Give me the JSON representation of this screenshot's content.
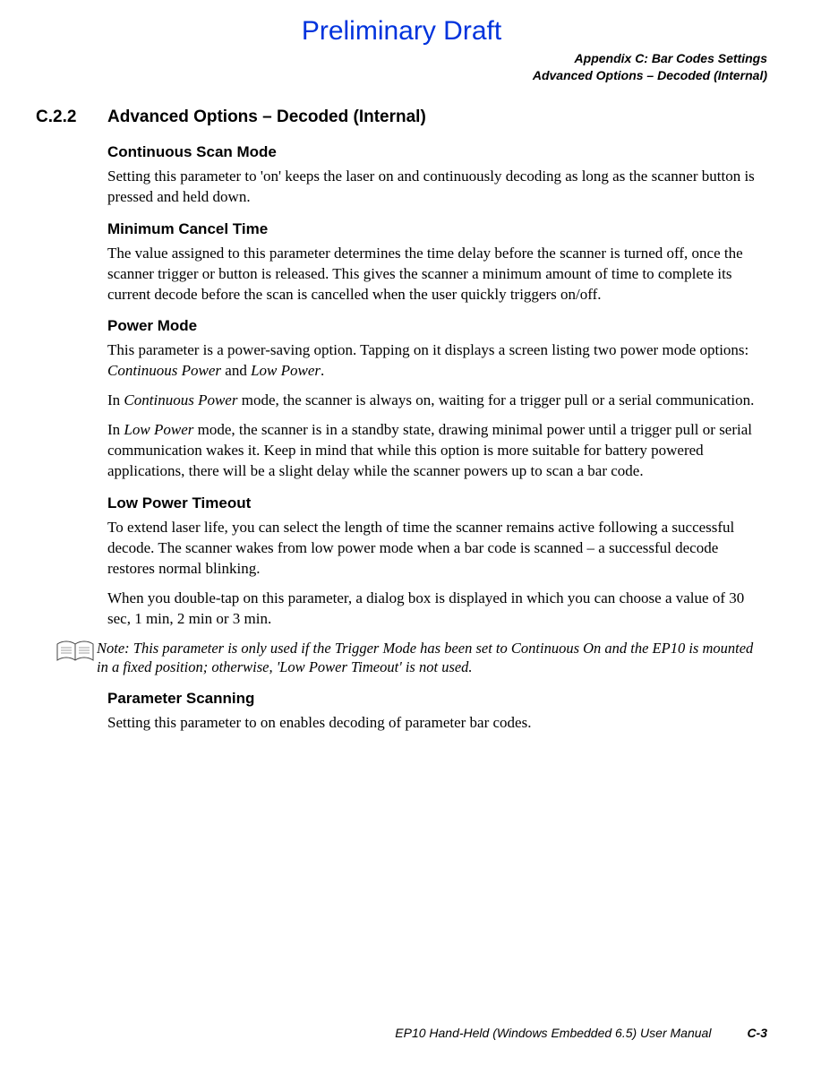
{
  "draft_banner": "Preliminary Draft",
  "header": {
    "line1": "Appendix C: Bar Codes Settings",
    "line2": "Advanced Options – Decoded (Internal)"
  },
  "section": {
    "number": "C.2.2",
    "title": "Advanced Options – Decoded (Internal)"
  },
  "continuous_scan": {
    "heading": "Continuous Scan Mode",
    "body": "Setting this parameter to 'on' keeps the laser on and continuously decoding as long as the scanner button is pressed and held down."
  },
  "min_cancel": {
    "heading": "Minimum Cancel Time",
    "body": "The value assigned to this parameter determines the time delay before the scanner is turned off, once the scanner trigger or button is released. This gives the scanner a minimum amount of time to complete its current decode before the scan is cancelled when the user quickly triggers on/off."
  },
  "power_mode": {
    "heading": "Power Mode",
    "p1_a": "This parameter is a power-saving option. Tapping on it displays a screen listing two power mode options: ",
    "p1_i1": "Continuous Power",
    "p1_mid": " and ",
    "p1_i2": "Low Power",
    "p1_end": ".",
    "p2_a": "In ",
    "p2_i": "Continuous Power",
    "p2_b": " mode, the scanner is always on, waiting for a trigger pull or a serial communication.",
    "p3_a": "In ",
    "p3_i": "Low Power",
    "p3_b": " mode, the scanner is in a standby state, drawing minimal power until a trigger pull or serial communication wakes it. Keep in mind that while this option is more suitable for battery powered applications, there will be a slight delay while the scanner powers up to scan a bar code."
  },
  "low_power_timeout": {
    "heading": "Low Power Timeout",
    "p1": "To extend laser life, you can select the length of time the scanner remains active following a successful decode. The scanner wakes from low power mode when a bar code is scanned – a successful decode restores normal blinking.",
    "p2": "When you double-tap on this parameter, a dialog box is displayed in which you can choose a value of 30 sec, 1 min, 2 min or 3 min."
  },
  "note": {
    "label": "Note: ",
    "body": "This parameter is only used if the Trigger Mode has been set to Continuous On and the EP10 is mounted in a fixed position; otherwise, 'Low Power Timeout' is not used."
  },
  "parameter_scanning": {
    "heading": "Parameter Scanning",
    "body": "Setting this parameter to on enables decoding of parameter bar codes."
  },
  "footer": {
    "manual": "EP10 Hand-Held (Windows Embedded 6.5) User Manual",
    "page": "C-3"
  }
}
